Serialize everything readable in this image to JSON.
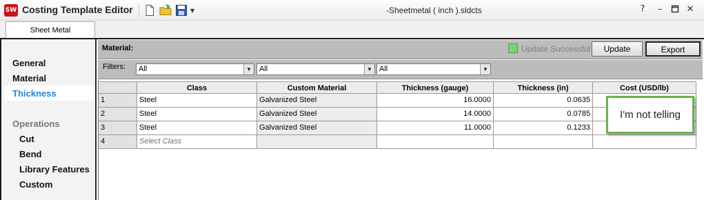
{
  "window": {
    "title": "Costing Template Editor",
    "logo_text": "SW",
    "document": "-Sheetmetal ( inch ).sldcts"
  },
  "tabs": [
    {
      "label": "Sheet Metal"
    }
  ],
  "nav": {
    "items": [
      "General",
      "Material",
      "Thickness"
    ],
    "active": "Thickness",
    "section": "Operations",
    "sub_items": [
      "Cut",
      "Bend",
      "Library Features",
      "Custom"
    ]
  },
  "material_bar": {
    "label": "Material:",
    "status": "Update Successful",
    "update_label": "Update",
    "export_label": "Export"
  },
  "filters": {
    "label": "Filters:",
    "combos": [
      "All",
      "All",
      "All"
    ]
  },
  "table": {
    "columns": [
      "Class",
      "Custom Material",
      "Thickness (gauge)",
      "Thickness (in)",
      "Cost (USD/lb)"
    ],
    "rows": [
      {
        "n": "1",
        "class": "Steel",
        "material": "Galvanized Steel",
        "gauge": "16.0000",
        "inch": "0.0635",
        "cost": ""
      },
      {
        "n": "2",
        "class": "Steel",
        "material": "Galvanized Steel",
        "gauge": "14.0000",
        "inch": "0.0785",
        "cost": ""
      },
      {
        "n": "3",
        "class": "Steel",
        "material": "Galvanized Steel",
        "gauge": "11.0000",
        "inch": "0.1233",
        "cost": ""
      }
    ],
    "new_row": {
      "n": "4",
      "placeholder": "Select Class"
    }
  },
  "note": {
    "text": "I'm not telling"
  },
  "colors": {
    "accent": "#1e88d8",
    "note_border": "#6bb24a",
    "status_check": "#7ad27a"
  }
}
